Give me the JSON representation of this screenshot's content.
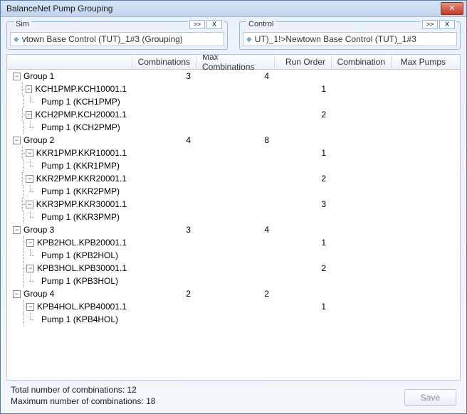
{
  "window": {
    "title": "BalanceNet Pump Grouping"
  },
  "dropzones": {
    "sim": {
      "label": "Sim",
      "value": "vtown Base Control (TUT)_1#3 (Grouping)",
      "expand_label": ">>",
      "clear_label": "X"
    },
    "control": {
      "label": "Control",
      "value": "UT)_1!>Newtown Base Control (TUT)_1#3",
      "expand_label": ">>",
      "clear_label": "X"
    }
  },
  "columns": {
    "tree": "",
    "combinations": "Combinations",
    "max_combinations": "Max Combinations",
    "run_order": "Run Order",
    "combination": "Combination",
    "max_pumps": "Max Pumps"
  },
  "rows": [
    {
      "type": "group",
      "label": "Group 1",
      "combinations": 3,
      "max_combinations": 4
    },
    {
      "type": "node",
      "label": "KCH1PMP.KCH10001.1",
      "run_order": 1
    },
    {
      "type": "pump",
      "label": "Pump 1 (KCH1PMP)"
    },
    {
      "type": "node",
      "label": "KCH2PMP.KCH20001.1",
      "run_order": 2
    },
    {
      "type": "pump",
      "label": "Pump 1 (KCH2PMP)"
    },
    {
      "type": "group",
      "label": "Group 2",
      "combinations": 4,
      "max_combinations": 8
    },
    {
      "type": "node",
      "label": "KKR1PMP.KKR10001.1",
      "run_order": 1
    },
    {
      "type": "pump",
      "label": "Pump 1 (KKR1PMP)"
    },
    {
      "type": "node",
      "label": "KKR2PMP.KKR20001.1",
      "run_order": 2
    },
    {
      "type": "pump",
      "label": "Pump 1 (KKR2PMP)"
    },
    {
      "type": "node",
      "label": "KKR3PMP.KKR30001.1",
      "run_order": 3
    },
    {
      "type": "pump",
      "label": "Pump 1 (KKR3PMP)"
    },
    {
      "type": "group",
      "label": "Group 3",
      "combinations": 3,
      "max_combinations": 4
    },
    {
      "type": "node",
      "label": "KPB2HOL.KPB20001.1",
      "run_order": 1
    },
    {
      "type": "pump",
      "label": "Pump 1 (KPB2HOL)"
    },
    {
      "type": "node",
      "label": "KPB3HOL.KPB30001.1",
      "run_order": 2
    },
    {
      "type": "pump",
      "label": "Pump 1 (KPB3HOL)"
    },
    {
      "type": "group",
      "label": "Group 4",
      "combinations": 2,
      "max_combinations": 2
    },
    {
      "type": "node",
      "label": "KPB4HOL.KPB40001.1",
      "run_order": 1
    },
    {
      "type": "pump",
      "label": "Pump 1 (KPB4HOL)"
    }
  ],
  "footer": {
    "total": "Total number of combinations: 12",
    "max": "Maximum number of combinations: 18",
    "save": "Save"
  }
}
